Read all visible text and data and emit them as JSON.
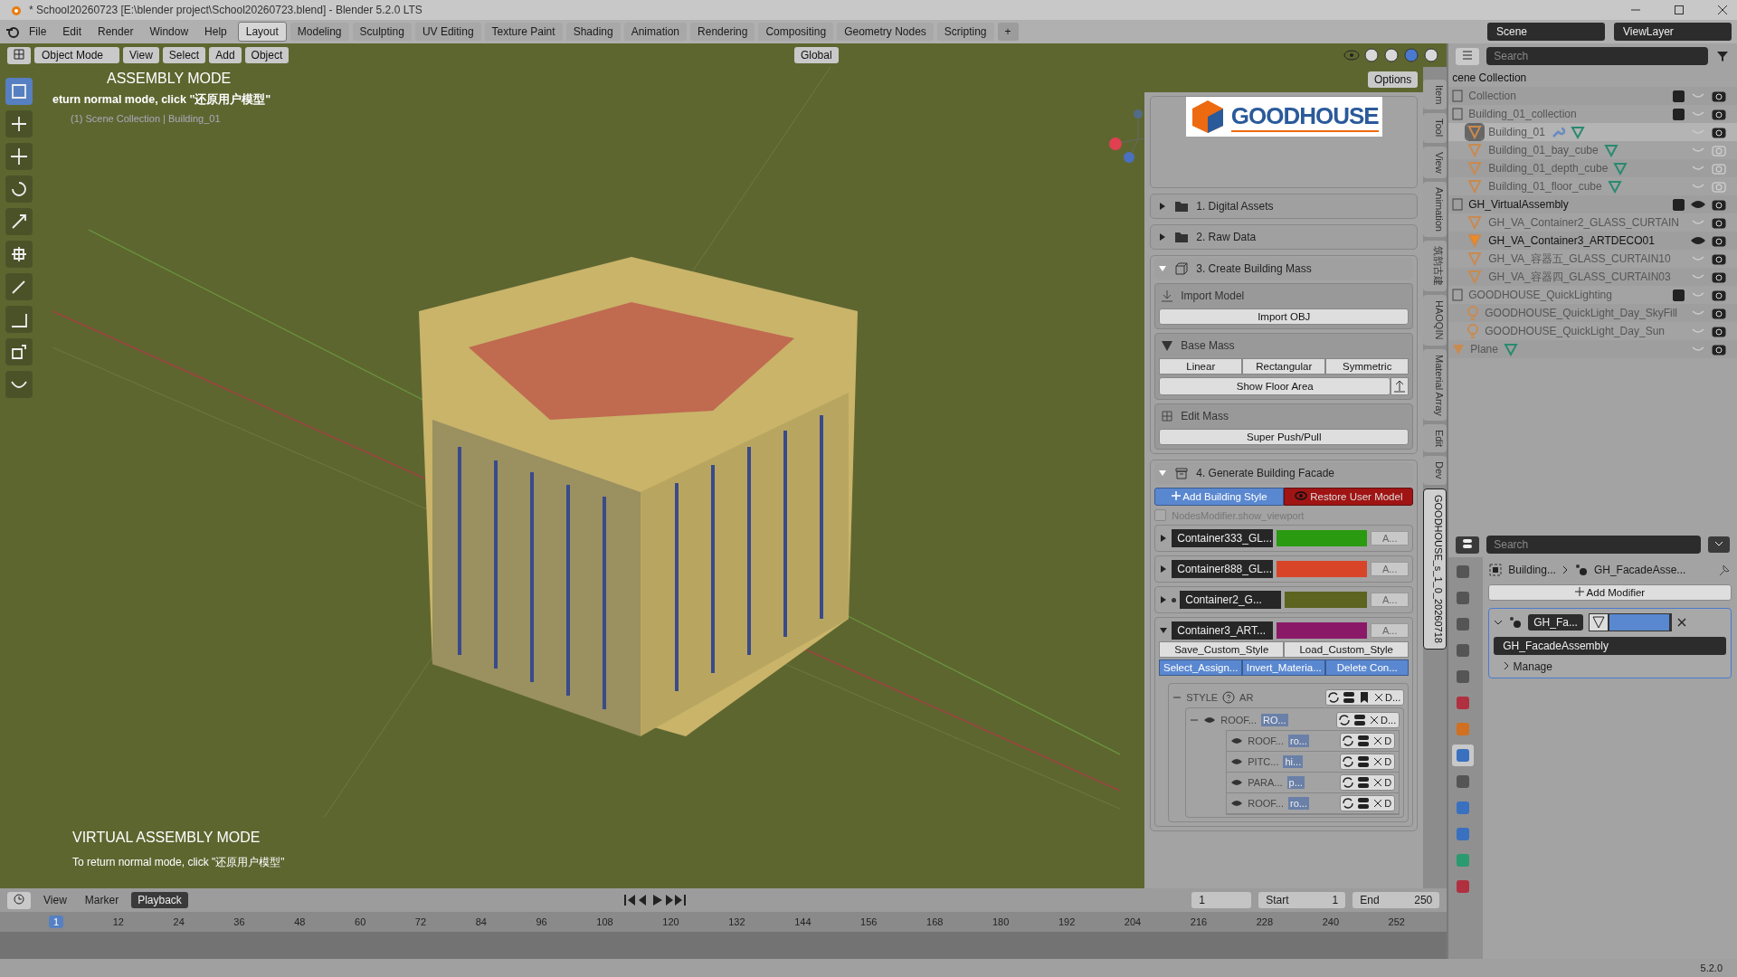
{
  "window": {
    "title": "* School20260723 [E:\\blender project\\School20260723.blend] - Blender 5.2.0 LTS"
  },
  "menu": [
    "File",
    "Edit",
    "Render",
    "Window",
    "Help"
  ],
  "workspaces": [
    {
      "label": "Layout",
      "selected": true
    },
    {
      "label": "Modeling",
      "selected": false
    },
    {
      "label": "Sculpting",
      "selected": false
    },
    {
      "label": "UV Editing",
      "selected": false
    },
    {
      "label": "Texture Paint",
      "selected": false
    },
    {
      "label": "Shading",
      "selected": false
    },
    {
      "label": "Animation",
      "selected": false
    },
    {
      "label": "Rendering",
      "selected": false
    },
    {
      "label": "Compositing",
      "selected": false
    },
    {
      "label": "Geometry Nodes",
      "selected": false
    },
    {
      "label": "Scripting",
      "selected": false
    }
  ],
  "add_workspace": "+",
  "scene": "Scene",
  "view_layer": "ViewLayer",
  "viewport_header": {
    "mode": "Object Mode",
    "menus": [
      "View",
      "Select",
      "Add",
      "Object"
    ],
    "orientation": "Global",
    "options": "Options",
    "shading": [
      {
        "selected": false
      },
      {
        "selected": false
      },
      {
        "selected": true
      },
      {
        "selected": false
      }
    ]
  },
  "tools": [
    {
      "kind": "select",
      "selected": true
    },
    {
      "kind": "cursor",
      "selected": false
    },
    {
      "kind": "move",
      "selected": false
    },
    {
      "kind": "rotate",
      "selected": false
    },
    {
      "kind": "scale",
      "selected": false
    },
    {
      "kind": "transform",
      "selected": false
    },
    {
      "kind": "annotate",
      "selected": false
    },
    {
      "kind": "measure",
      "selected": false
    },
    {
      "kind": "add",
      "selected": false
    },
    {
      "kind": "curve",
      "selected": false
    }
  ],
  "viewport": {
    "overlay_title": "ASSEMBLY MODE",
    "overlay_hint": "eturn normal mode, click \"还原用户模型\"",
    "context": "(1) Scene Collection | Building_01",
    "banner_title": "VIRTUAL ASSEMBLY MODE",
    "banner_text": "To return normal mode, click \"还原用户模型\""
  },
  "panel": {
    "logo": "GOODHOUSE",
    "sections": [
      {
        "label": "1. Digital Assets",
        "expanded": false
      },
      {
        "label": "2. Raw Data",
        "expanded": false
      }
    ],
    "mass": {
      "label": "3. Create Building Mass",
      "expanded": true,
      "import_title": "Import Model",
      "import_button": "Import OBJ",
      "base_title": "Base Mass",
      "base_buttons": [
        "Linear",
        "Rectangular",
        "Symmetric"
      ],
      "floor_button": "Show Floor Area",
      "edit_title": "Edit Mass",
      "push_button": "Super Push/Pull"
    },
    "facade": {
      "label": "4. Generate Building Facade",
      "expanded": true,
      "add_button": "Add Building Style",
      "restore_button": "Restore User Model",
      "toggle": {
        "label": "NodesModifier.show_viewport",
        "checked": false
      },
      "containers": [
        {
          "name": "Container333_GL...",
          "color": "#2a9a10",
          "apply": "A...",
          "marked": false,
          "expanded": false
        },
        {
          "name": "Container888_GL...",
          "color": "#d84428",
          "apply": "A...",
          "marked": false,
          "expanded": false
        },
        {
          "name": "Container2_G...",
          "color": "#5c6420",
          "apply": "A...",
          "marked": true,
          "expanded": false
        },
        {
          "name": "Container3_ART...",
          "color": "#8a1a68",
          "apply": "A...",
          "marked": false,
          "expanded": true,
          "actions": [
            "Save_Custom_Style",
            "Load_Custom_Style"
          ],
          "tools": [
            "Select_Assign...",
            "Invert_Materia...",
            "Delete Con..."
          ],
          "style": {
            "label": "STYLE",
            "code": "AR",
            "delete": "D...",
            "group": {
              "label": "ROOF...",
              "thumb": "RO...",
              "delete": "D...",
              "children": [
                {
                  "label": "ROOF...",
                  "thumb": "ro...",
                  "delete": "D"
                },
                {
                  "label": "PITC...",
                  "thumb": "hi...",
                  "delete": "D"
                },
                {
                  "label": "PARA...",
                  "thumb": "p...",
                  "delete": "D"
                },
                {
                  "label": "ROOF...",
                  "thumb": "ro...",
                  "delete": "D"
                }
              ]
            }
          }
        }
      ]
    }
  },
  "side_tabs": [
    {
      "label": "Item",
      "selected": false
    },
    {
      "label": "Tool",
      "selected": false
    },
    {
      "label": "View",
      "selected": false
    },
    {
      "label": "Animation",
      "selected": false
    },
    {
      "label": "筑韵古建",
      "selected": false
    },
    {
      "label": "HAOQIN",
      "selected": false
    },
    {
      "label": "Material Array",
      "selected": false
    },
    {
      "label": "Edit",
      "selected": false
    },
    {
      "label": "Dev",
      "selected": false
    },
    {
      "label": "GOODHOUSE_s_1_0_20260718",
      "selected": true
    }
  ],
  "outliner": {
    "search_placeholder": "Search",
    "root": "cene Collection",
    "items": [
      {
        "kind": "collection",
        "name": "Collection",
        "checked": true,
        "visible": false,
        "renderable": true
      },
      {
        "kind": "collection",
        "name": "Building_01_collection",
        "checked": true,
        "visible": false,
        "renderable": true,
        "children": [
          {
            "kind": "mesh",
            "name": "Building_01",
            "visible": false,
            "renderable": true,
            "selected": true,
            "modifier": true,
            "mesh_data": true
          },
          {
            "kind": "mesh",
            "name": "Building_01_bay_cube",
            "visible": false,
            "renderable": false,
            "selected": false,
            "modifier": false,
            "mesh_data": true
          },
          {
            "kind": "mesh",
            "name": "Building_01_depth_cube",
            "visible": false,
            "renderable": false,
            "selected": false,
            "modifier": false,
            "mesh_data": true
          },
          {
            "kind": "mesh",
            "name": "Building_01_floor_cube",
            "visible": false,
            "renderable": false,
            "selected": false,
            "modifier": false,
            "mesh_data": true
          }
        ]
      },
      {
        "kind": "collection",
        "name": "GH_VirtualAssembly",
        "checked": true,
        "visible": true,
        "renderable": true,
        "children": [
          {
            "kind": "mesh",
            "name": "GH_VA_Container2_GLASS_CURTAIN",
            "visible": false,
            "renderable": true,
            "selected": false,
            "modifier": false,
            "mesh_data": false
          },
          {
            "kind": "mesh",
            "name": "GH_VA_Container3_ARTDECO01",
            "visible": true,
            "renderable": true,
            "selected": false,
            "modifier": false,
            "mesh_data": false
          },
          {
            "kind": "mesh",
            "name": "GH_VA_容器五_GLASS_CURTAIN10",
            "visible": false,
            "renderable": true,
            "selected": false,
            "modifier": false,
            "mesh_data": false
          },
          {
            "kind": "mesh",
            "name": "GH_VA_容器四_GLASS_CURTAIN03",
            "visible": false,
            "renderable": true,
            "selected": false,
            "modifier": false,
            "mesh_data": false
          }
        ]
      },
      {
        "kind": "collection",
        "name": "GOODHOUSE_QuickLighting",
        "checked": true,
        "visible": false,
        "renderable": true,
        "children": [
          {
            "kind": "light",
            "name": "GOODHOUSE_QuickLight_Day_SkyFill",
            "visible": false,
            "renderable": true
          },
          {
            "kind": "light",
            "name": "GOODHOUSE_QuickLight_Day_Sun",
            "visible": false,
            "renderable": true
          }
        ]
      },
      {
        "kind": "mesh",
        "name": "Plane",
        "visible": false,
        "renderable": true,
        "mesh_data": true
      }
    ]
  },
  "properties": {
    "search_placeholder": "Search",
    "breadcrumb": [
      "Building...",
      "GH_FacadeAsse..."
    ],
    "add_modifier": "Add Modifier",
    "tabs": [
      {
        "kind": "tool",
        "selected": false
      },
      {
        "kind": "render",
        "selected": false
      },
      {
        "kind": "output",
        "selected": false
      },
      {
        "kind": "view-layer",
        "selected": false
      },
      {
        "kind": "scene",
        "selected": false
      },
      {
        "kind": "world",
        "selected": false
      },
      {
        "kind": "object",
        "selected": false
      },
      {
        "kind": "modifier",
        "selected": true
      },
      {
        "kind": "particles",
        "selected": false
      },
      {
        "kind": "physics",
        "selected": false
      },
      {
        "kind": "constraints",
        "selected": false
      },
      {
        "kind": "data",
        "selected": false
      },
      {
        "kind": "material",
        "selected": false
      }
    ],
    "modifier": {
      "name": "GH_Fa...",
      "expanded": true,
      "node_group": "GH_FacadeAssembly",
      "manage": "Manage"
    }
  },
  "timeline": {
    "menus": [
      "View",
      "Marker",
      "Playback"
    ],
    "current_frame": "1",
    "start_label": "Start",
    "start": "1",
    "end_label": "End",
    "end": "250",
    "ticks": [
      "1",
      "12",
      "24",
      "36",
      "48",
      "60",
      "72",
      "84",
      "96",
      "108",
      "120",
      "132",
      "144",
      "156",
      "168",
      "180",
      "192",
      "204",
      "216",
      "228",
      "240",
      "252"
    ]
  },
  "status_bar": {
    "version": "5.2.0"
  }
}
